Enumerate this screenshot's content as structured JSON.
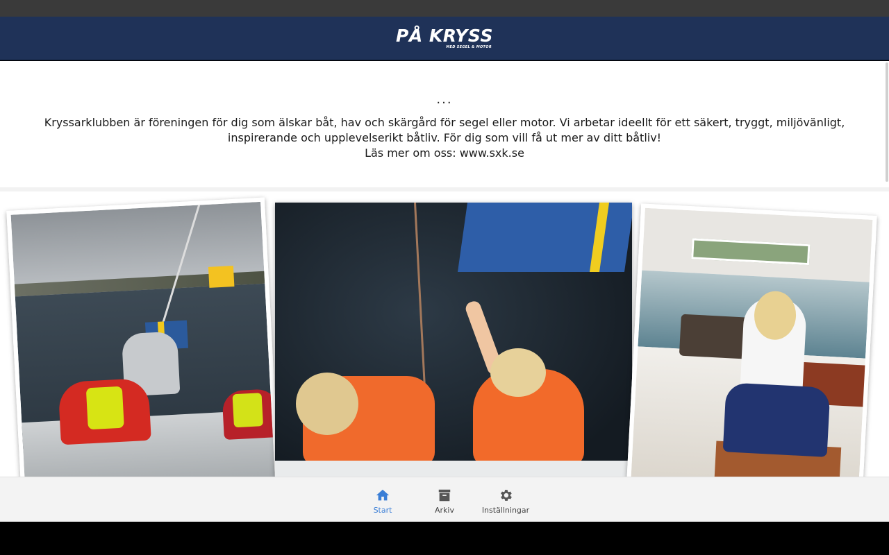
{
  "header": {
    "logo_main": "PÅ KRYSS",
    "logo_sub": "MED SEGEL & MOTOR"
  },
  "intro": {
    "ellipsis": "...",
    "body": "Kryssarklubben är föreningen för dig som älskar båt, hav och skärgård för segel eller motor. Vi arbetar ideellt för ett säkert, tryggt, miljövänligt, inspirerande och upplevelserikt båtliv. För dig som vill få ut mer av ditt båtliv!",
    "link_text": "Läs mer om oss: www.sxk.se"
  },
  "nav": {
    "items": [
      {
        "label": "Start",
        "icon": "home-icon",
        "active": true
      },
      {
        "label": "Arkiv",
        "icon": "archive-icon",
        "active": false
      },
      {
        "label": "Inställningar",
        "icon": "gear-icon",
        "active": false
      }
    ]
  },
  "colors": {
    "header_bg": "#1f3258",
    "active_nav": "#3a7ed6",
    "inactive_nav": "#555555"
  }
}
